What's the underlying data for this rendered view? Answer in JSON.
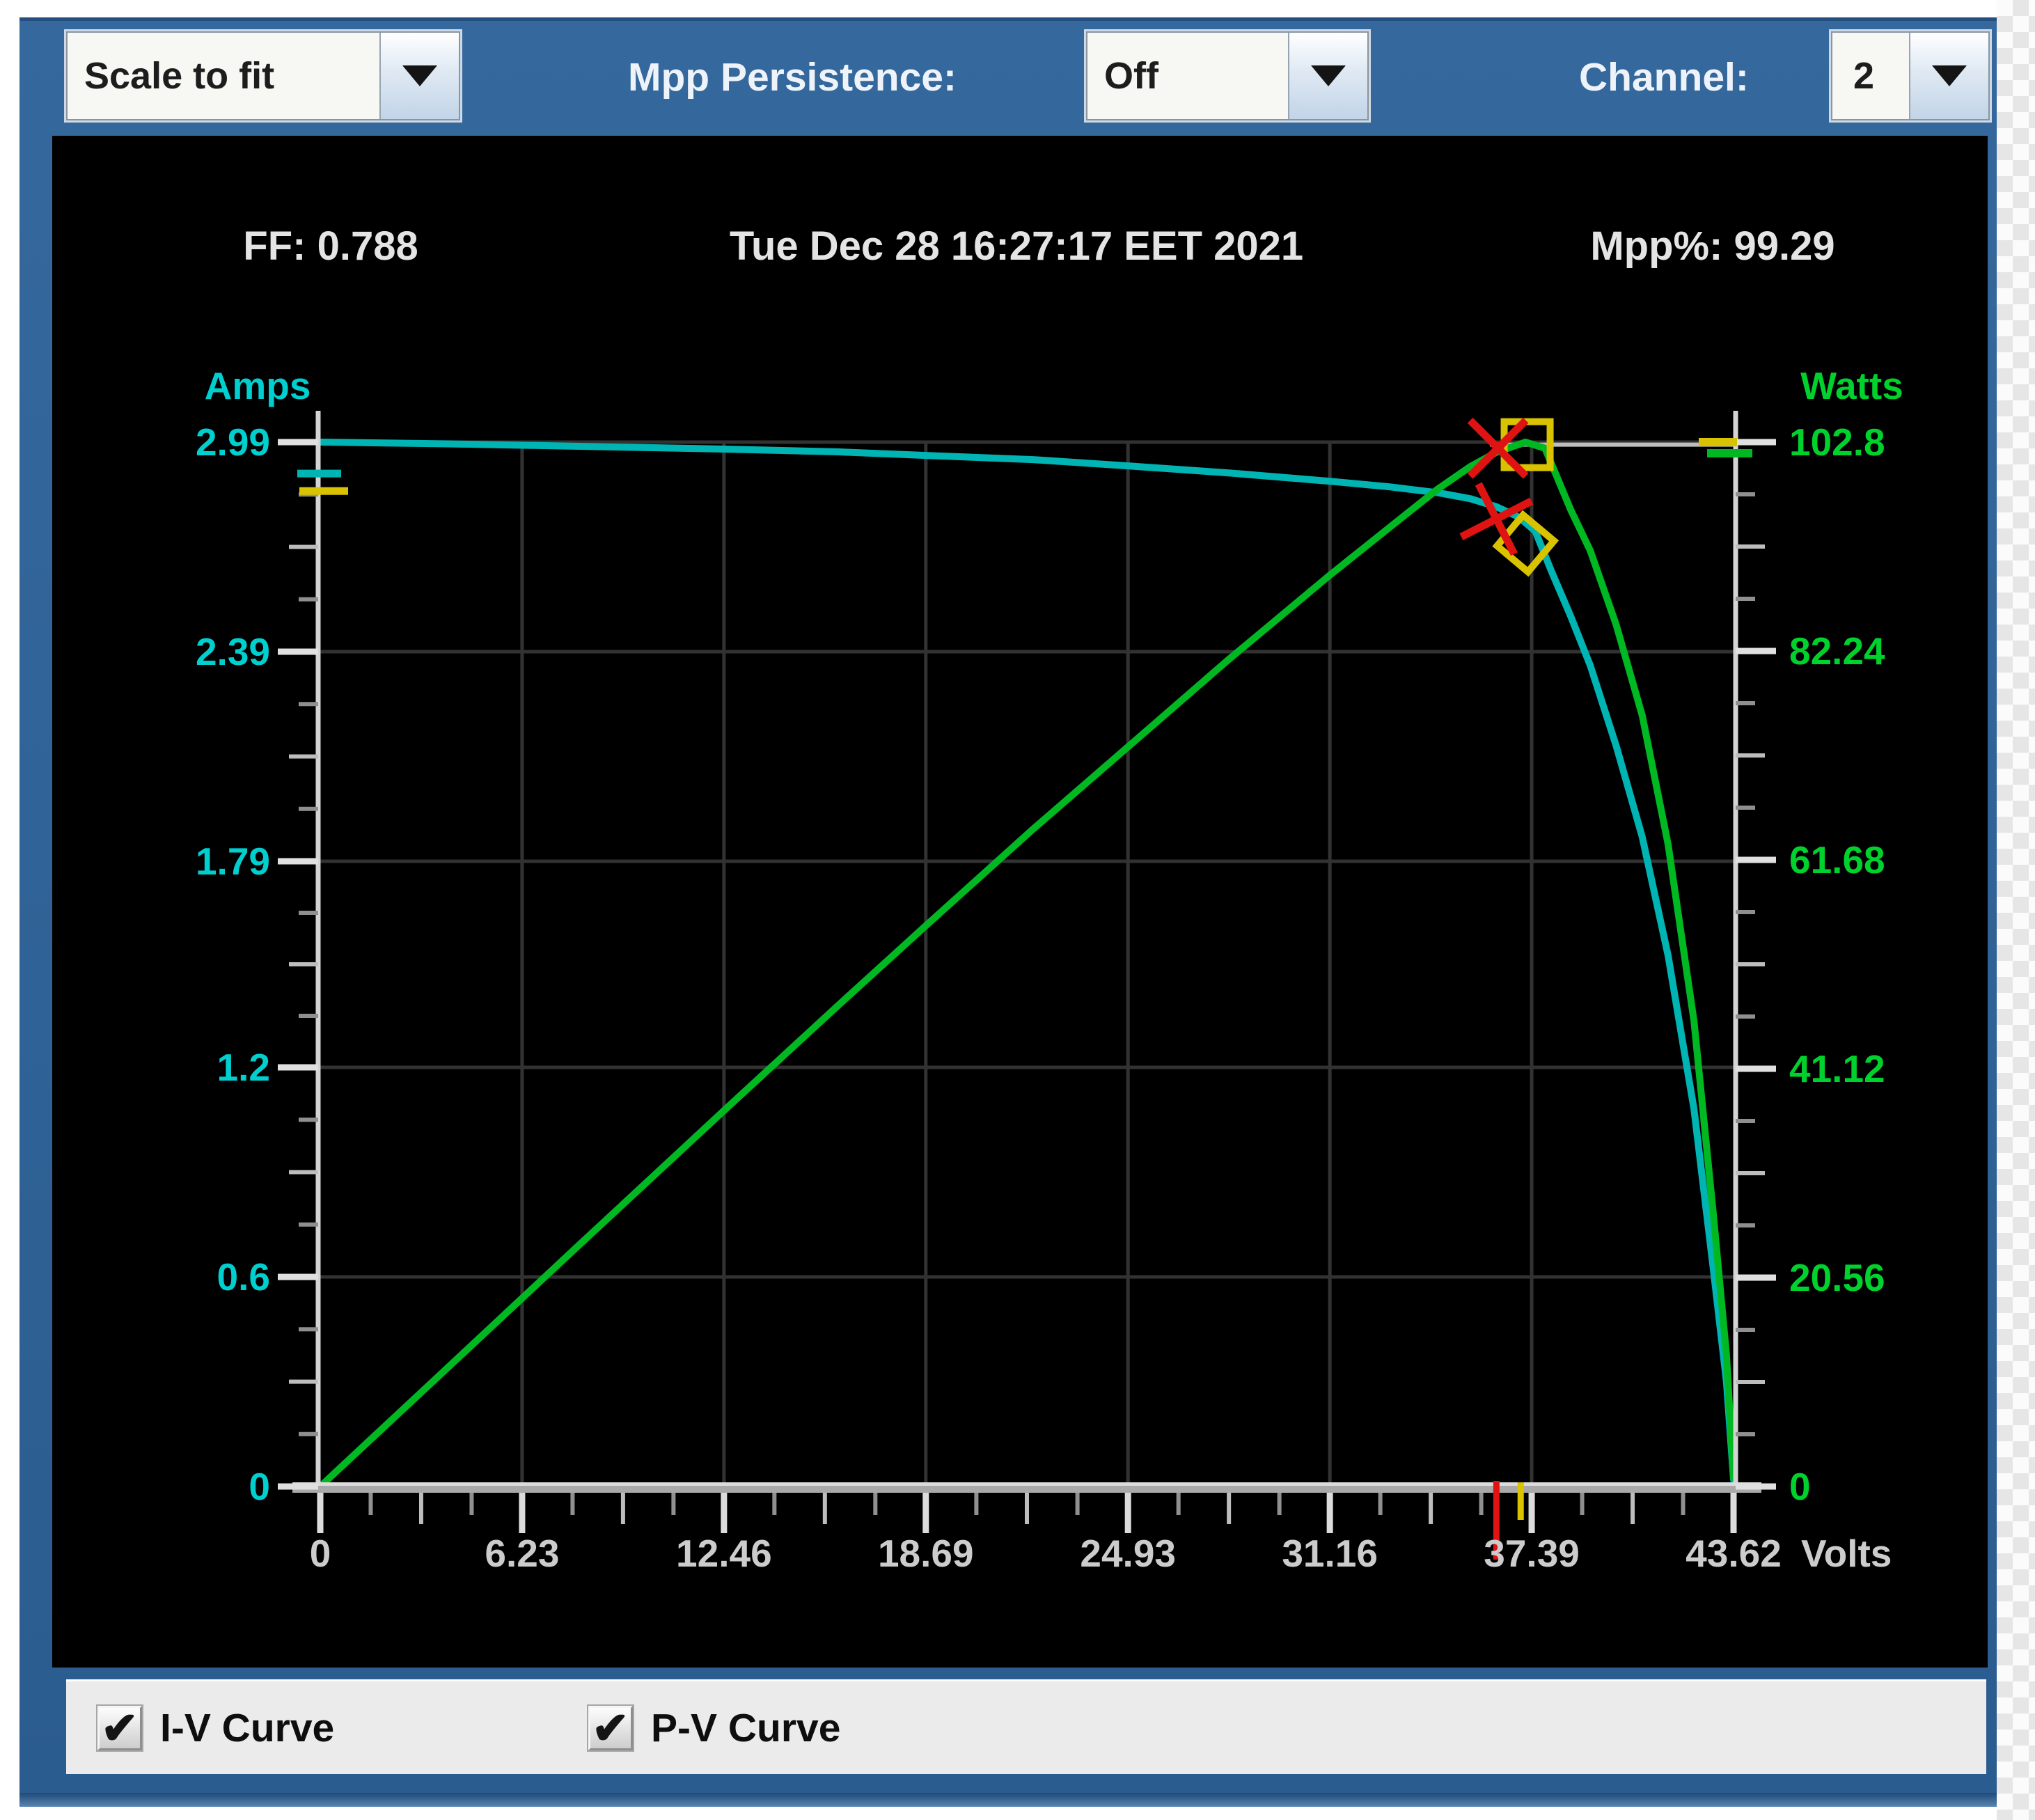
{
  "toolbar": {
    "scale_select": {
      "value": "Scale to fit"
    },
    "mpp_persistence_label": "Mpp Persistence:",
    "mpp_persistence_select": {
      "value": "Off"
    },
    "channel_label": "Channel:",
    "channel_select": {
      "value": "2"
    }
  },
  "header": {
    "ff": "FF: 0.788",
    "timestamp": "Tue Dec 28 16:27:17 EET 2021",
    "mpp_percent": "Mpp%: 99.29"
  },
  "footer": {
    "iv_checkbox_label": "I-V Curve",
    "iv_checked": true,
    "pv_checkbox_label": "P-V Curve",
    "pv_checked": true
  },
  "chart_data": {
    "type": "line",
    "title": "",
    "xlabel": "Volts",
    "xlim": [
      0,
      43.62
    ],
    "grid": true,
    "x_ticks": [
      {
        "label": "0",
        "value": 0
      },
      {
        "label": "6.23",
        "value": 6.23
      },
      {
        "label": "12.46",
        "value": 12.46
      },
      {
        "label": "18.69",
        "value": 18.69
      },
      {
        "label": "24.93",
        "value": 24.93
      },
      {
        "label": "31.16",
        "value": 31.16
      },
      {
        "label": "37.39",
        "value": 37.39
      },
      {
        "label": "43.62",
        "value": 43.62
      }
    ],
    "left_axis": {
      "label": "Amps",
      "ylim": [
        0,
        2.99
      ],
      "ticks": [
        {
          "label": "2.99",
          "value": 2.99
        },
        {
          "label": "2.39",
          "value": 2.39
        },
        {
          "label": "1.79",
          "value": 1.79
        },
        {
          "label": "1.2",
          "value": 1.2
        },
        {
          "label": "0.6",
          "value": 0.6
        },
        {
          "label": "0",
          "value": 0
        }
      ]
    },
    "right_axis": {
      "label": "Watts",
      "ylim": [
        0,
        102.8
      ],
      "ticks": [
        {
          "label": "102.8",
          "value": 102.8
        },
        {
          "label": "82.24",
          "value": 82.24
        },
        {
          "label": "61.68",
          "value": 61.68
        },
        {
          "label": "41.12",
          "value": 41.12
        },
        {
          "label": "20.56",
          "value": 20.56
        },
        {
          "label": "0",
          "value": 0
        }
      ]
    },
    "series": [
      {
        "name": "I-V Curve",
        "yaxis": "left",
        "color": "#00b4b4",
        "points": [
          [
            0,
            2.99
          ],
          [
            4,
            2.985
          ],
          [
            8,
            2.978
          ],
          [
            12.46,
            2.97
          ],
          [
            16,
            2.962
          ],
          [
            18.69,
            2.952
          ],
          [
            22,
            2.94
          ],
          [
            24.93,
            2.922
          ],
          [
            28,
            2.902
          ],
          [
            31.16,
            2.878
          ],
          [
            33,
            2.862
          ],
          [
            34.5,
            2.845
          ],
          [
            35.5,
            2.828
          ],
          [
            36.3,
            2.805
          ],
          [
            37,
            2.775
          ],
          [
            37.5,
            2.735
          ],
          [
            38,
            2.62
          ],
          [
            38.6,
            2.49
          ],
          [
            39.2,
            2.35
          ],
          [
            40,
            2.12
          ],
          [
            40.8,
            1.86
          ],
          [
            41.6,
            1.52
          ],
          [
            42.4,
            1.08
          ],
          [
            43,
            0.62
          ],
          [
            43.4,
            0.3
          ],
          [
            43.62,
            0.02
          ]
        ]
      },
      {
        "name": "P-V Curve",
        "yaxis": "right",
        "color": "#00b822",
        "points": [
          [
            0,
            0
          ],
          [
            4,
            11.9
          ],
          [
            8,
            23.8
          ],
          [
            12.46,
            37.0
          ],
          [
            16,
            47.4
          ],
          [
            18.69,
            55.2
          ],
          [
            22,
            64.7
          ],
          [
            24.93,
            72.8
          ],
          [
            28,
            81.3
          ],
          [
            31.16,
            89.7
          ],
          [
            33,
            94.4
          ],
          [
            34.5,
            98.2
          ],
          [
            35.5,
            100.4
          ],
          [
            36.3,
            101.8
          ],
          [
            37.2,
            102.8
          ],
          [
            37.8,
            102.2
          ],
          [
            38.6,
            96.1
          ],
          [
            39.2,
            92.1
          ],
          [
            40,
            84.8
          ],
          [
            40.8,
            75.9
          ],
          [
            41.6,
            63.2
          ],
          [
            42.4,
            45.8
          ],
          [
            43,
            26.7
          ],
          [
            43.4,
            13.0
          ],
          [
            43.62,
            0.9
          ]
        ]
      }
    ],
    "markers": {
      "mpp_square": {
        "v": 37.25,
        "w": 102.55
      },
      "mpp_diamond": {
        "v": 37.2,
        "i": 2.7
      },
      "red_cross_power": {
        "v": 36.35,
        "w": 102.2
      },
      "red_cross_current": {
        "v": 36.3,
        "i": 2.77
      },
      "pmax_line": {
        "w": 102.55,
        "from_v": 36.1
      },
      "left_axis_current_marks": {
        "cyan": 2.9,
        "yellow": 2.85
      },
      "right_axis_power_marks": {
        "yellow": 102.8,
        "green": 101.7
      },
      "x_axis_voltage_marks": {
        "red": 36.3,
        "yellow": 37.05
      }
    },
    "colors": {
      "iv_curve": "#00b4b4",
      "pv_curve": "#00b822",
      "amps_labels": "#00cfcf",
      "watts_labels": "#00d22d",
      "volts_labels": "#cccccc",
      "grid": "#323232",
      "axis": "#d4d4d4",
      "marker_yellow": "#d9c300",
      "marker_red": "#e01313"
    }
  }
}
